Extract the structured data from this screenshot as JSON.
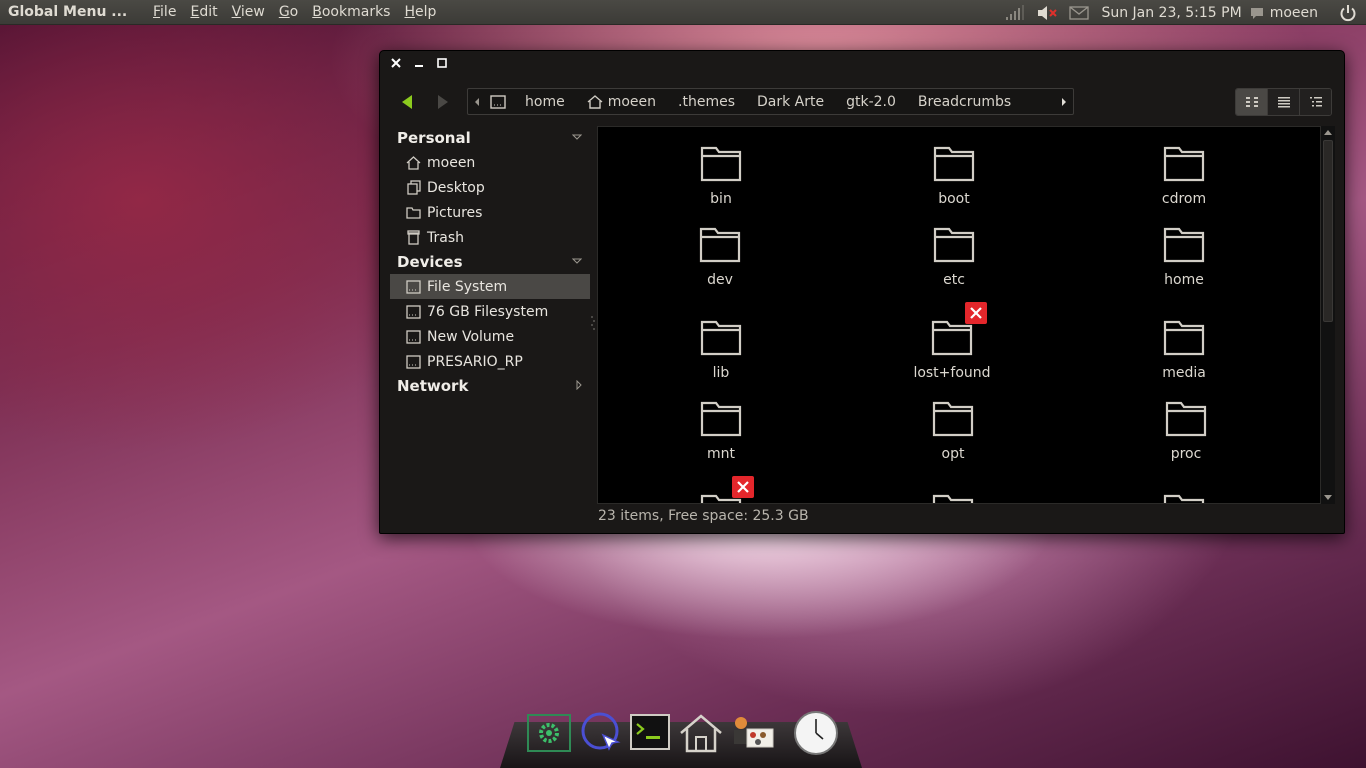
{
  "panel": {
    "app_title": "Global Menu ...",
    "menus": [
      {
        "label": "File",
        "accel": "F",
        "rest": "ile"
      },
      {
        "label": "Edit",
        "accel": "E",
        "rest": "dit"
      },
      {
        "label": "View",
        "accel": "V",
        "rest": "iew"
      },
      {
        "label": "Go",
        "accel": "G",
        "rest": "o"
      },
      {
        "label": "Bookmarks",
        "accel": "B",
        "rest": "ookmarks"
      },
      {
        "label": "Help",
        "accel": "H",
        "rest": "elp"
      }
    ],
    "clock": "Sun Jan 23,  5:15 PM",
    "user": "moeen"
  },
  "window": {
    "breadcrumbs": [
      "home",
      "moeen",
      ".themes",
      "Dark Arte",
      "gtk-2.0",
      "Breadcrumbs"
    ],
    "sidebar": {
      "personal_header": "Personal",
      "personal": [
        "moeen",
        "Desktop",
        "Pictures",
        "Trash"
      ],
      "devices_header": "Devices",
      "devices": [
        "File System",
        "76 GB Filesystem",
        "New Volume",
        "PRESARIO_RP"
      ],
      "network_header": "Network"
    },
    "files": [
      "bin",
      "boot",
      "cdrom",
      "dev",
      "etc",
      "home",
      "lib",
      "lost+found",
      "media",
      "mnt",
      "opt",
      "proc"
    ],
    "status": "23 items, Free space: 25.3 GB"
  },
  "colors": {
    "accent_green": "#8ccb1e",
    "emblem_red": "#e4262b",
    "panel_bg": "#3c3b37",
    "window_bg": "#1a1817"
  }
}
